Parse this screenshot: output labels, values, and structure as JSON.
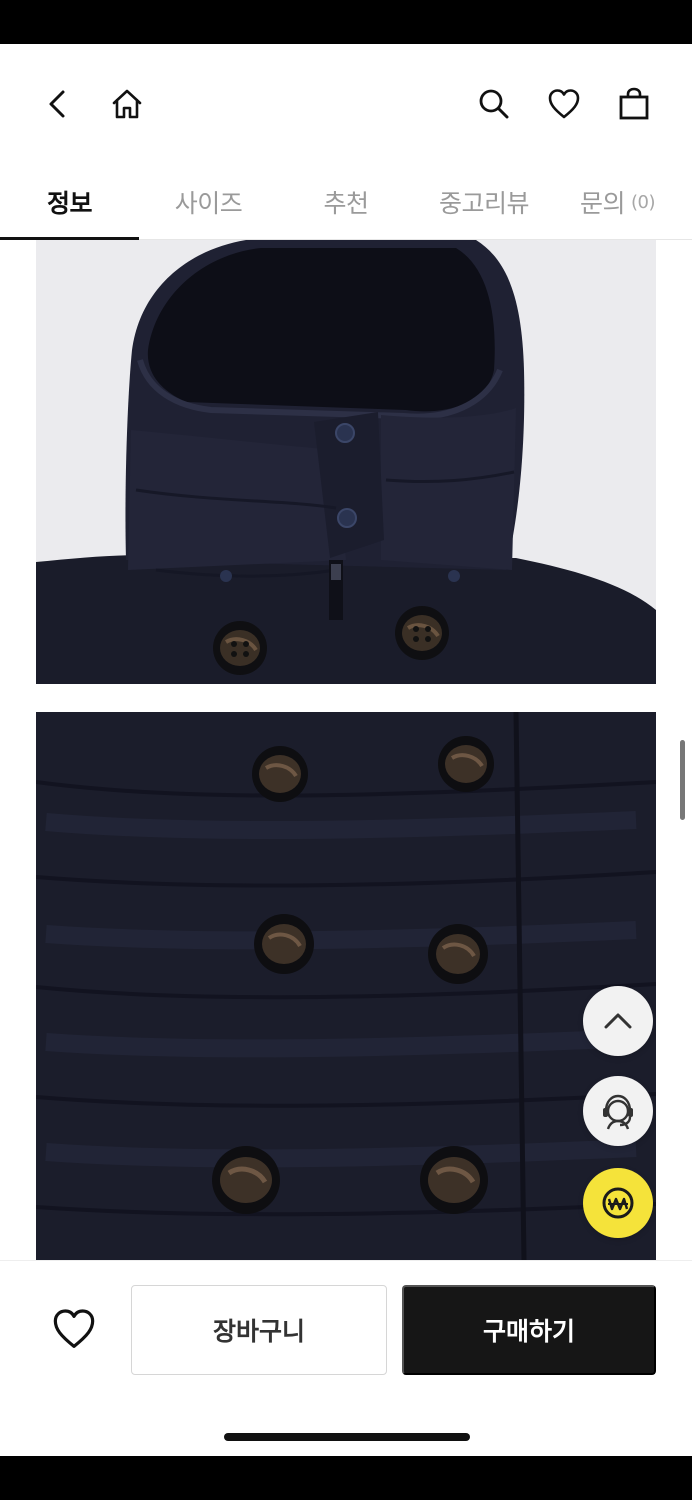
{
  "header": {
    "back_icon": "chevron-left-icon",
    "home_icon": "home-icon",
    "search_icon": "search-icon",
    "wishlist_icon": "heart-icon",
    "cart_icon": "shopping-bag-icon"
  },
  "tabs": [
    {
      "label": "정보",
      "active": true
    },
    {
      "label": "사이즈",
      "active": false
    },
    {
      "label": "추천",
      "active": false
    },
    {
      "label": "중고리뷰",
      "active": false
    },
    {
      "label": "문의",
      "count": "(0)",
      "active": false
    }
  ],
  "content": {
    "photos": [
      {
        "subject": "navy padded jacket hood detail"
      },
      {
        "subject": "navy padded jacket front buttons"
      }
    ]
  },
  "floating": {
    "scroll_top_icon": "chevron-up-icon",
    "support_icon": "customer-support-icon",
    "pay_icon": "won-pay-icon"
  },
  "bottom_bar": {
    "wish_icon": "heart-outline-icon",
    "cart_label": "장바구니",
    "buy_label": "구매하기"
  },
  "colors": {
    "accent_pay": "#f5e33a",
    "buy_button": "#161616",
    "tab_active": "#111111",
    "tab_inactive": "#9a9a9a"
  }
}
